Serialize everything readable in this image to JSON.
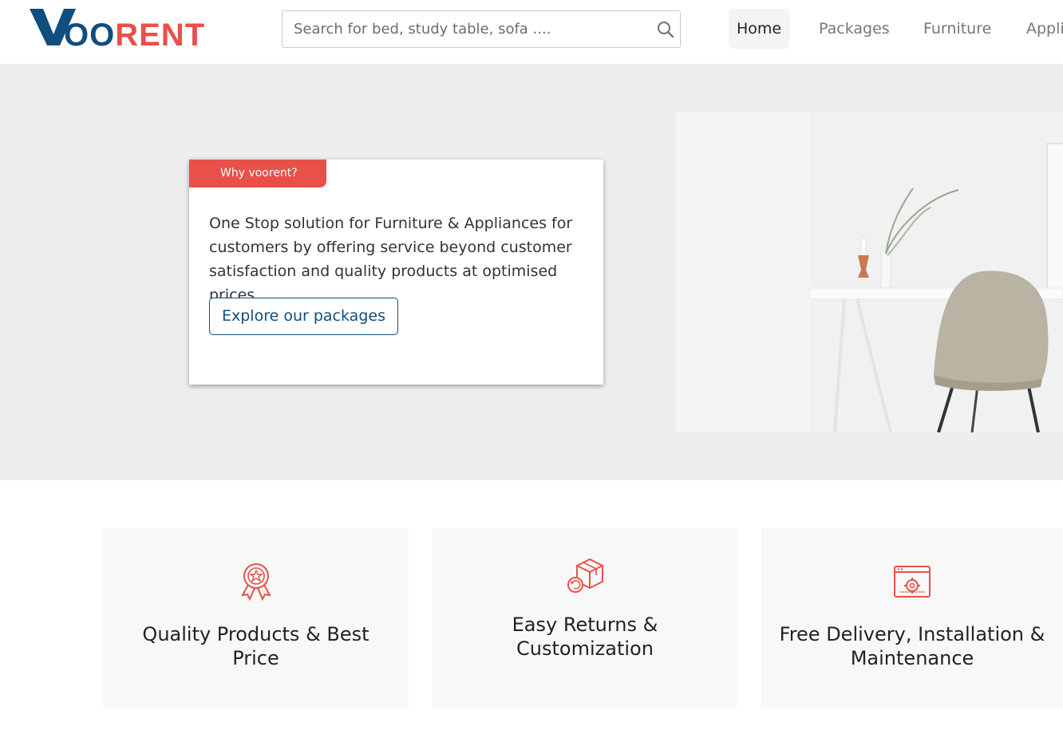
{
  "header": {
    "logo": {
      "text_v": "V",
      "text_oo": "OO",
      "text_rent": "RENT"
    },
    "search": {
      "placeholder": "Search for bed, study table, sofa ....",
      "icon": "search-icon"
    },
    "nav": [
      {
        "label": "Home",
        "active": true
      },
      {
        "label": "Packages"
      },
      {
        "label": "Furniture"
      },
      {
        "label": "Appli"
      }
    ]
  },
  "hero": {
    "tag": "Why voorent?",
    "text": "One Stop solution for Furniture & Appliances for customers by offering service beyond customer satisfaction and quality products at optimised prices.",
    "button": "Explore our packages",
    "image": "desk-chair-photo"
  },
  "features": [
    {
      "icon": "award-ribbon-icon",
      "title": "Quality Products & Best Price"
    },
    {
      "icon": "return-box-icon",
      "title": "Easy Returns & Customization"
    },
    {
      "icon": "delivery-installation-icon",
      "title": "Free Delivery, Installation & Maintenance"
    }
  ],
  "colors": {
    "brand_blue": "#0f4e7e",
    "brand_red": "#e8514a",
    "hero_bg": "#eeeeee",
    "card_bg": "#f8f8f8"
  }
}
